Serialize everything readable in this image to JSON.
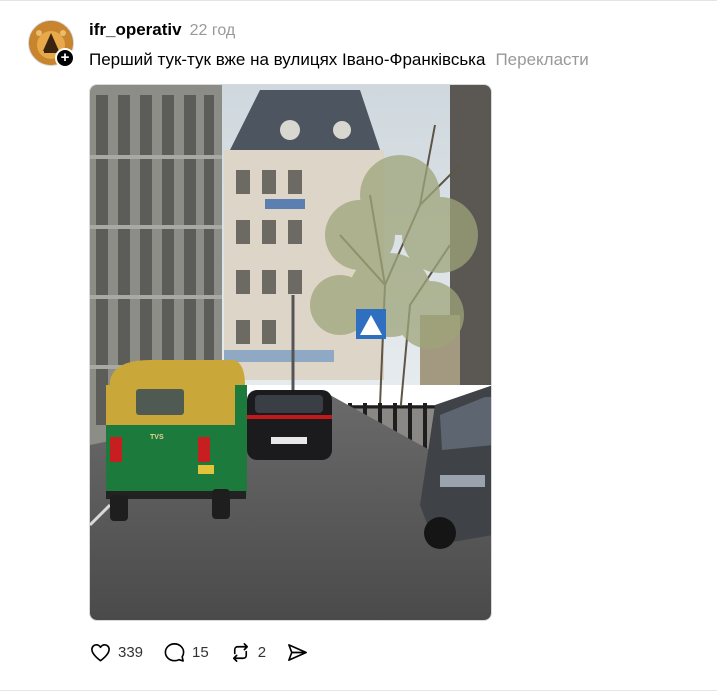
{
  "post": {
    "username": "ifr_operativ",
    "time": "22 год",
    "caption": "Перший тук-тук вже на вулицях Івано-Франківська",
    "translate_label": "Перекласти",
    "follow_symbol": "+",
    "image_alt": "Tuk-tuk on a street in Ivano-Frankivsk",
    "actions": {
      "like_count": "339",
      "comment_count": "15",
      "repost_count": "2"
    }
  },
  "icons": {
    "like": "heart-icon",
    "comment": "comment-bubble-icon",
    "repost": "repost-icon",
    "share": "send-icon"
  }
}
